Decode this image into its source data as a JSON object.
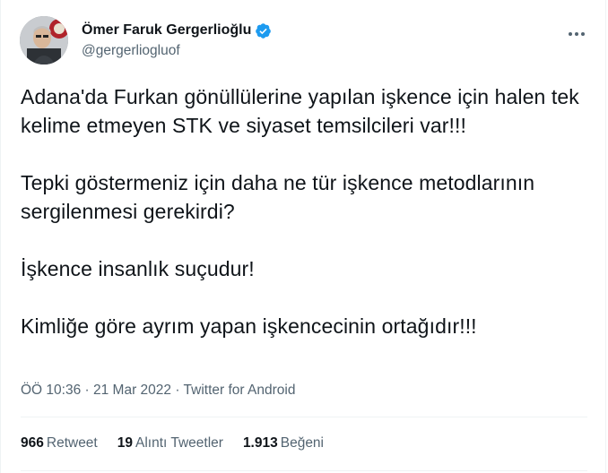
{
  "author": {
    "display_name": "Ömer Faruk Gergerlioğlu",
    "handle": "@gergerliogluof",
    "verified_icon": "verified-badge-icon"
  },
  "tweet": {
    "paragraphs": [
      "Adana'da Furkan gönüllülerine yapılan işkence için halen tek kelime etmeyen STK ve siyaset temsilcileri var!!!",
      "Tepki göstermeniz için daha ne tür işkence metodlarının sergilenmesi gerekirdi?",
      "İşkence insanlık suçudur!",
      "Kimliğe göre ayrım yapan işkencecinin ortağıdır!!!"
    ],
    "time": "ÖÖ 10:36",
    "date": "21 Mar 2022",
    "source": "Twitter for Android",
    "separator": "·"
  },
  "stats": {
    "retweets_count": "966",
    "retweets_label": "Retweet",
    "quotes_count": "19",
    "quotes_label": "Alıntı Tweetler",
    "likes_count": "1.913",
    "likes_label": "Beğeni"
  },
  "colors": {
    "text": "#0f1419",
    "secondary": "#536471",
    "verified": "#1d9bf0",
    "divider": "#eff3f4"
  }
}
